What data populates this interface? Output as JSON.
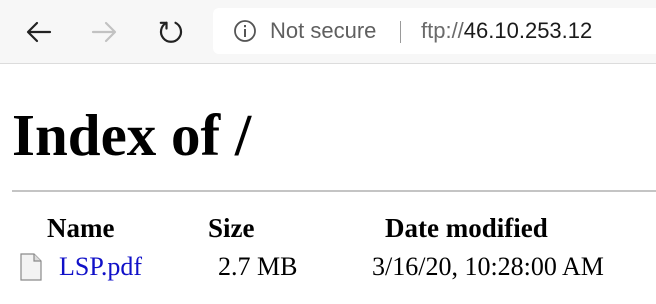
{
  "browser": {
    "security_label": "Not secure",
    "url_scheme": "ftp://",
    "url_host": "46.10.253.12",
    "icons": [
      "back-arrow-icon",
      "forward-arrow-icon",
      "refresh-icon",
      "info-icon"
    ]
  },
  "page": {
    "title": "Index of /",
    "columns": {
      "name": "Name",
      "size": "Size",
      "date": "Date modified"
    },
    "files": [
      {
        "name": "LSP.pdf",
        "size": "2.7 MB",
        "date": "3/16/20, 10:28:00 AM",
        "icon": "file-icon"
      }
    ],
    "link_color": "#1010c8"
  }
}
